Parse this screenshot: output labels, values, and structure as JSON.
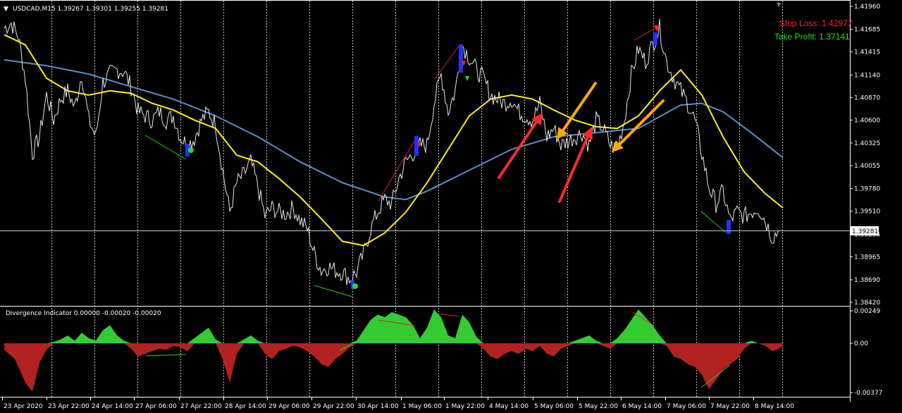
{
  "colors": {
    "background": "#000000",
    "price": "#e6e6e6",
    "ma_fast": "#ffee22",
    "ma_slow": "#5b8fc7",
    "hist_pos": "#33cc33",
    "hist_neg": "#b22222",
    "stop_loss": "#ff2020",
    "take_profit": "#22dd22",
    "arrow_red": "#ff2a2a",
    "arrow_orange": "#ffaa00",
    "grid": "#ffffff",
    "divergence_bear": "#dd2222",
    "divergence_bull": "#22cc22"
  },
  "chart_data": [
    {
      "type": "line",
      "symbol_header": "USDCAD,M15  1.39267 1.39301 1.39255 1.39281",
      "stop_loss_text": "Stop Loss: 1.42977",
      "take_profit_text": "Take Profit: 1.37141",
      "current_price_label": "1.39281",
      "current_price": 1.39281,
      "ylim": [
        1.3842,
        1.4196
      ],
      "y_ticks": [
        "1.41960",
        "1.41685",
        "1.41415",
        "1.41140",
        "1.40870",
        "1.40600",
        "1.40325",
        "1.40055",
        "1.39780",
        "1.39510",
        "1.39235",
        "1.38965",
        "1.38690",
        "1.38420"
      ],
      "x_ticks": [
        "23 Apr 2020",
        "23 Apr 22:00",
        "24 Apr 14:00",
        "27 Apr 06:00",
        "27 Apr 22:00",
        "28 Apr 14:00",
        "29 Apr 06:00",
        "29 Apr 22:00",
        "30 Apr 14:00",
        "1 May 06:00",
        "1 May 22:00",
        "4 May 14:00",
        "5 May 06:00",
        "5 May 22:00",
        "6 May 14:00",
        "7 May 06:00",
        "7 May 22:00",
        "8 May 14:00"
      ],
      "series": [
        {
          "values": [
            [
              0,
              1.417
            ],
            [
              10,
              1.4176
            ],
            [
              20,
              1.416
            ],
            [
              30,
              1.411
            ],
            [
              40,
              1.402
            ],
            [
              50,
              1.404
            ],
            [
              60,
              1.409
            ],
            [
              70,
              1.406
            ],
            [
              80,
              1.4085
            ],
            [
              90,
              1.4095
            ],
            [
              100,
              1.4075
            ],
            [
              110,
              1.4115
            ],
            [
              120,
              1.406
            ],
            [
              130,
              1.404
            ],
            [
              140,
              1.4105
            ],
            [
              150,
              1.4115
            ],
            [
              160,
              1.412
            ],
            [
              170,
              1.4118
            ],
            [
              180,
              1.41
            ],
            [
              190,
              1.407
            ],
            [
              200,
              1.4065
            ],
            [
              210,
              1.406
            ],
            [
              220,
              1.407
            ],
            [
              230,
              1.406
            ],
            [
              240,
              1.4065
            ],
            [
              250,
              1.404
            ],
            [
              260,
              1.403
            ],
            [
              270,
              1.4038
            ],
            [
              280,
              1.406
            ],
            [
              290,
              1.407
            ],
            [
              300,
              1.4055
            ],
            [
              310,
              1.4
            ],
            [
              320,
              1.395
            ],
            [
              330,
              1.3985
            ],
            [
              340,
              1.3995
            ],
            [
              350,
              1.401
            ],
            [
              360,
              1.398
            ],
            [
              370,
              1.3945
            ],
            [
              380,
              1.3955
            ],
            [
              390,
              1.395
            ],
            [
              400,
              1.3948
            ],
            [
              410,
              1.3955
            ],
            [
              420,
              1.394
            ],
            [
              430,
              1.393
            ],
            [
              440,
              1.39
            ],
            [
              450,
              1.388
            ],
            [
              460,
              1.3885
            ],
            [
              470,
              1.388
            ],
            [
              480,
              1.3878
            ],
            [
              490,
              1.387
            ],
            [
              500,
              1.3878
            ],
            [
              510,
              1.39
            ],
            [
              520,
              1.393
            ],
            [
              530,
              1.395
            ],
            [
              540,
              1.3965
            ],
            [
              550,
              1.396
            ],
            [
              560,
              1.399
            ],
            [
              570,
              1.401
            ],
            [
              580,
              1.402
            ],
            [
              590,
              1.403
            ],
            [
              600,
              1.403
            ],
            [
              610,
              1.408
            ],
            [
              620,
              1.4115
            ],
            [
              630,
              1.407
            ],
            [
              640,
              1.4095
            ],
            [
              650,
              1.415
            ],
            [
              660,
              1.4135
            ],
            [
              670,
              1.412
            ],
            [
              680,
              1.411
            ],
            [
              690,
              1.409
            ],
            [
              700,
              1.4085
            ],
            [
              710,
              1.408
            ],
            [
              720,
              1.4085
            ],
            [
              730,
              1.407
            ],
            [
              740,
              1.4065
            ],
            [
              750,
              1.406
            ],
            [
              760,
              1.408
            ],
            [
              770,
              1.404
            ],
            [
              780,
              1.405
            ],
            [
              790,
              1.403
            ],
            [
              800,
              1.4035
            ],
            [
              810,
              1.404
            ],
            [
              820,
              1.4045
            ],
            [
              830,
              1.403
            ],
            [
              840,
              1.406
            ],
            [
              850,
              1.405
            ],
            [
              860,
              1.403
            ],
            [
              870,
              1.4025
            ],
            [
              880,
              1.406
            ],
            [
              890,
              1.4115
            ],
            [
              900,
              1.4145
            ],
            [
              910,
              1.413
            ],
            [
              920,
              1.415
            ],
            [
              930,
              1.417
            ],
            [
              940,
              1.413
            ],
            [
              950,
              1.411
            ],
            [
              960,
              1.4095
            ],
            [
              970,
              1.408
            ],
            [
              980,
              1.406
            ],
            [
              990,
              1.402
            ],
            [
              1000,
              1.398
            ],
            [
              1010,
              1.396
            ],
            [
              1020,
              1.3975
            ],
            [
              1030,
              1.394
            ],
            [
              1040,
              1.395
            ],
            [
              1050,
              1.3945
            ],
            [
              1060,
              1.395
            ],
            [
              1070,
              1.3955
            ],
            [
              1080,
              1.394
            ],
            [
              1090,
              1.392
            ],
            [
              1100,
              1.3928
            ]
          ]
        },
        {
          "values": [
            [
              0,
              1.4162
            ],
            [
              30,
              1.415
            ],
            [
              60,
              1.411
            ],
            [
              90,
              1.4095
            ],
            [
              120,
              1.409
            ],
            [
              150,
              1.4095
            ],
            [
              180,
              1.4092
            ],
            [
              210,
              1.408
            ],
            [
              240,
              1.4072
            ],
            [
              270,
              1.406
            ],
            [
              300,
              1.405
            ],
            [
              330,
              1.4018
            ],
            [
              360,
              1.401
            ],
            [
              390,
              1.399
            ],
            [
              420,
              1.3968
            ],
            [
              450,
              1.3942
            ],
            [
              480,
              1.3915
            ],
            [
              510,
              1.391
            ],
            [
              540,
              1.3925
            ],
            [
              570,
              1.395
            ],
            [
              600,
              1.3985
            ],
            [
              630,
              1.4025
            ],
            [
              660,
              1.4065
            ],
            [
              690,
              1.4085
            ],
            [
              720,
              1.409
            ],
            [
              750,
              1.4085
            ],
            [
              780,
              1.4072
            ],
            [
              810,
              1.406
            ],
            [
              840,
              1.4052
            ],
            [
              870,
              1.405
            ],
            [
              900,
              1.4065
            ],
            [
              930,
              1.4095
            ],
            [
              960,
              1.412
            ],
            [
              990,
              1.409
            ],
            [
              1020,
              1.404
            ],
            [
              1050,
              1.3998
            ],
            [
              1080,
              1.3972
            ],
            [
              1105,
              1.3955
            ]
          ]
        },
        {
          "values": [
            [
              0,
              1.4132
            ],
            [
              60,
              1.4125
            ],
            [
              120,
              1.4115
            ],
            [
              180,
              1.41
            ],
            [
              240,
              1.4085
            ],
            [
              300,
              1.4065
            ],
            [
              360,
              1.404
            ],
            [
              420,
              1.401
            ],
            [
              480,
              1.3985
            ],
            [
              540,
              1.3968
            ],
            [
              570,
              1.3965
            ],
            [
              600,
              1.3975
            ],
            [
              660,
              1.4
            ],
            [
              720,
              1.4025
            ],
            [
              780,
              1.404
            ],
            [
              840,
              1.4045
            ],
            [
              900,
              1.405
            ],
            [
              960,
              1.4078
            ],
            [
              990,
              1.408
            ],
            [
              1020,
              1.407
            ],
            [
              1060,
              1.4045
            ],
            [
              1105,
              1.4015
            ]
          ]
        }
      ]
    },
    {
      "type": "area",
      "title_text": "Divergence Indicator 0.00000 -0.00020 -0.00020",
      "ylim": [
        -0.00377,
        0.00249
      ],
      "y_ticks": [
        "0.00249",
        "0.00",
        "-0.00377"
      ],
      "x": [
        0,
        15,
        30,
        40,
        50,
        60,
        70,
        80,
        90,
        100,
        110,
        120,
        130,
        140,
        150,
        160,
        170,
        180,
        190,
        200,
        210,
        220,
        230,
        240,
        250,
        260,
        270,
        280,
        290,
        300,
        310,
        320,
        330,
        340,
        350,
        360,
        370,
        380,
        390,
        400,
        410,
        420,
        430,
        440,
        450,
        460,
        470,
        480,
        490,
        500,
        510,
        520,
        530,
        540,
        550,
        560,
        570,
        580,
        590,
        600,
        610,
        620,
        630,
        640,
        650,
        660,
        670,
        680,
        690,
        700,
        710,
        720,
        730,
        740,
        750,
        760,
        770,
        780,
        790,
        800,
        810,
        820,
        830,
        840,
        850,
        860,
        870,
        880,
        890,
        900,
        910,
        920,
        930,
        940,
        950,
        960,
        970,
        980,
        990,
        1000,
        1010,
        1020,
        1030,
        1040,
        1050,
        1060,
        1070,
        1080,
        1090,
        1100,
        1105
      ],
      "values": [
        -0.0005,
        -0.0012,
        -0.003,
        -0.0037,
        -0.0015,
        -0.0005,
        0.0001,
        0.0003,
        0.0006,
        0.0002,
        0.0008,
        0.0004,
        0.0002,
        0.001,
        0.0014,
        0.0006,
        0.0002,
        -0.0004,
        -0.001,
        -0.0008,
        -0.0006,
        -0.0004,
        -0.0005,
        -0.0002,
        -0.0003,
        -0.0006,
        0.0004,
        0.0008,
        0.0012,
        0.0003,
        -0.0012,
        -0.003,
        -0.0008,
        0.0003,
        0.0006,
        0.0002,
        -0.0008,
        -0.0012,
        -0.0006,
        -0.0004,
        -0.0002,
        -0.0003,
        -0.0006,
        -0.001,
        -0.0016,
        -0.0018,
        -0.0012,
        -0.0008,
        -0.0003,
        0.0002,
        0.001,
        0.0018,
        0.0022,
        0.002,
        0.0024,
        0.0022,
        0.002,
        0.0014,
        0.0004,
        0.0012,
        0.0026,
        0.002,
        0.0006,
        0.0004,
        0.0022,
        0.0016,
        0.0005,
        -0.0004,
        -0.001,
        -0.0012,
        -0.0008,
        -0.0006,
        -0.0008,
        -0.0004,
        -0.0006,
        -0.0002,
        -0.0008,
        -0.001,
        -0.0004,
        -0.0002,
        0.0002,
        0.0004,
        0.0006,
        0.0002,
        -0.0002,
        -0.0004,
        0.0004,
        0.001,
        0.0018,
        0.0026,
        0.002,
        0.0014,
        0.0006,
        -0.0002,
        -0.001,
        -0.0012,
        -0.0016,
        -0.0018,
        -0.0024,
        -0.0035,
        -0.0028,
        -0.002,
        -0.0016,
        -0.0012,
        -0.0004,
        0.0002,
        0.0,
        -0.0002,
        -0.0006,
        -0.0004,
        -0.0002
      ]
    }
  ]
}
